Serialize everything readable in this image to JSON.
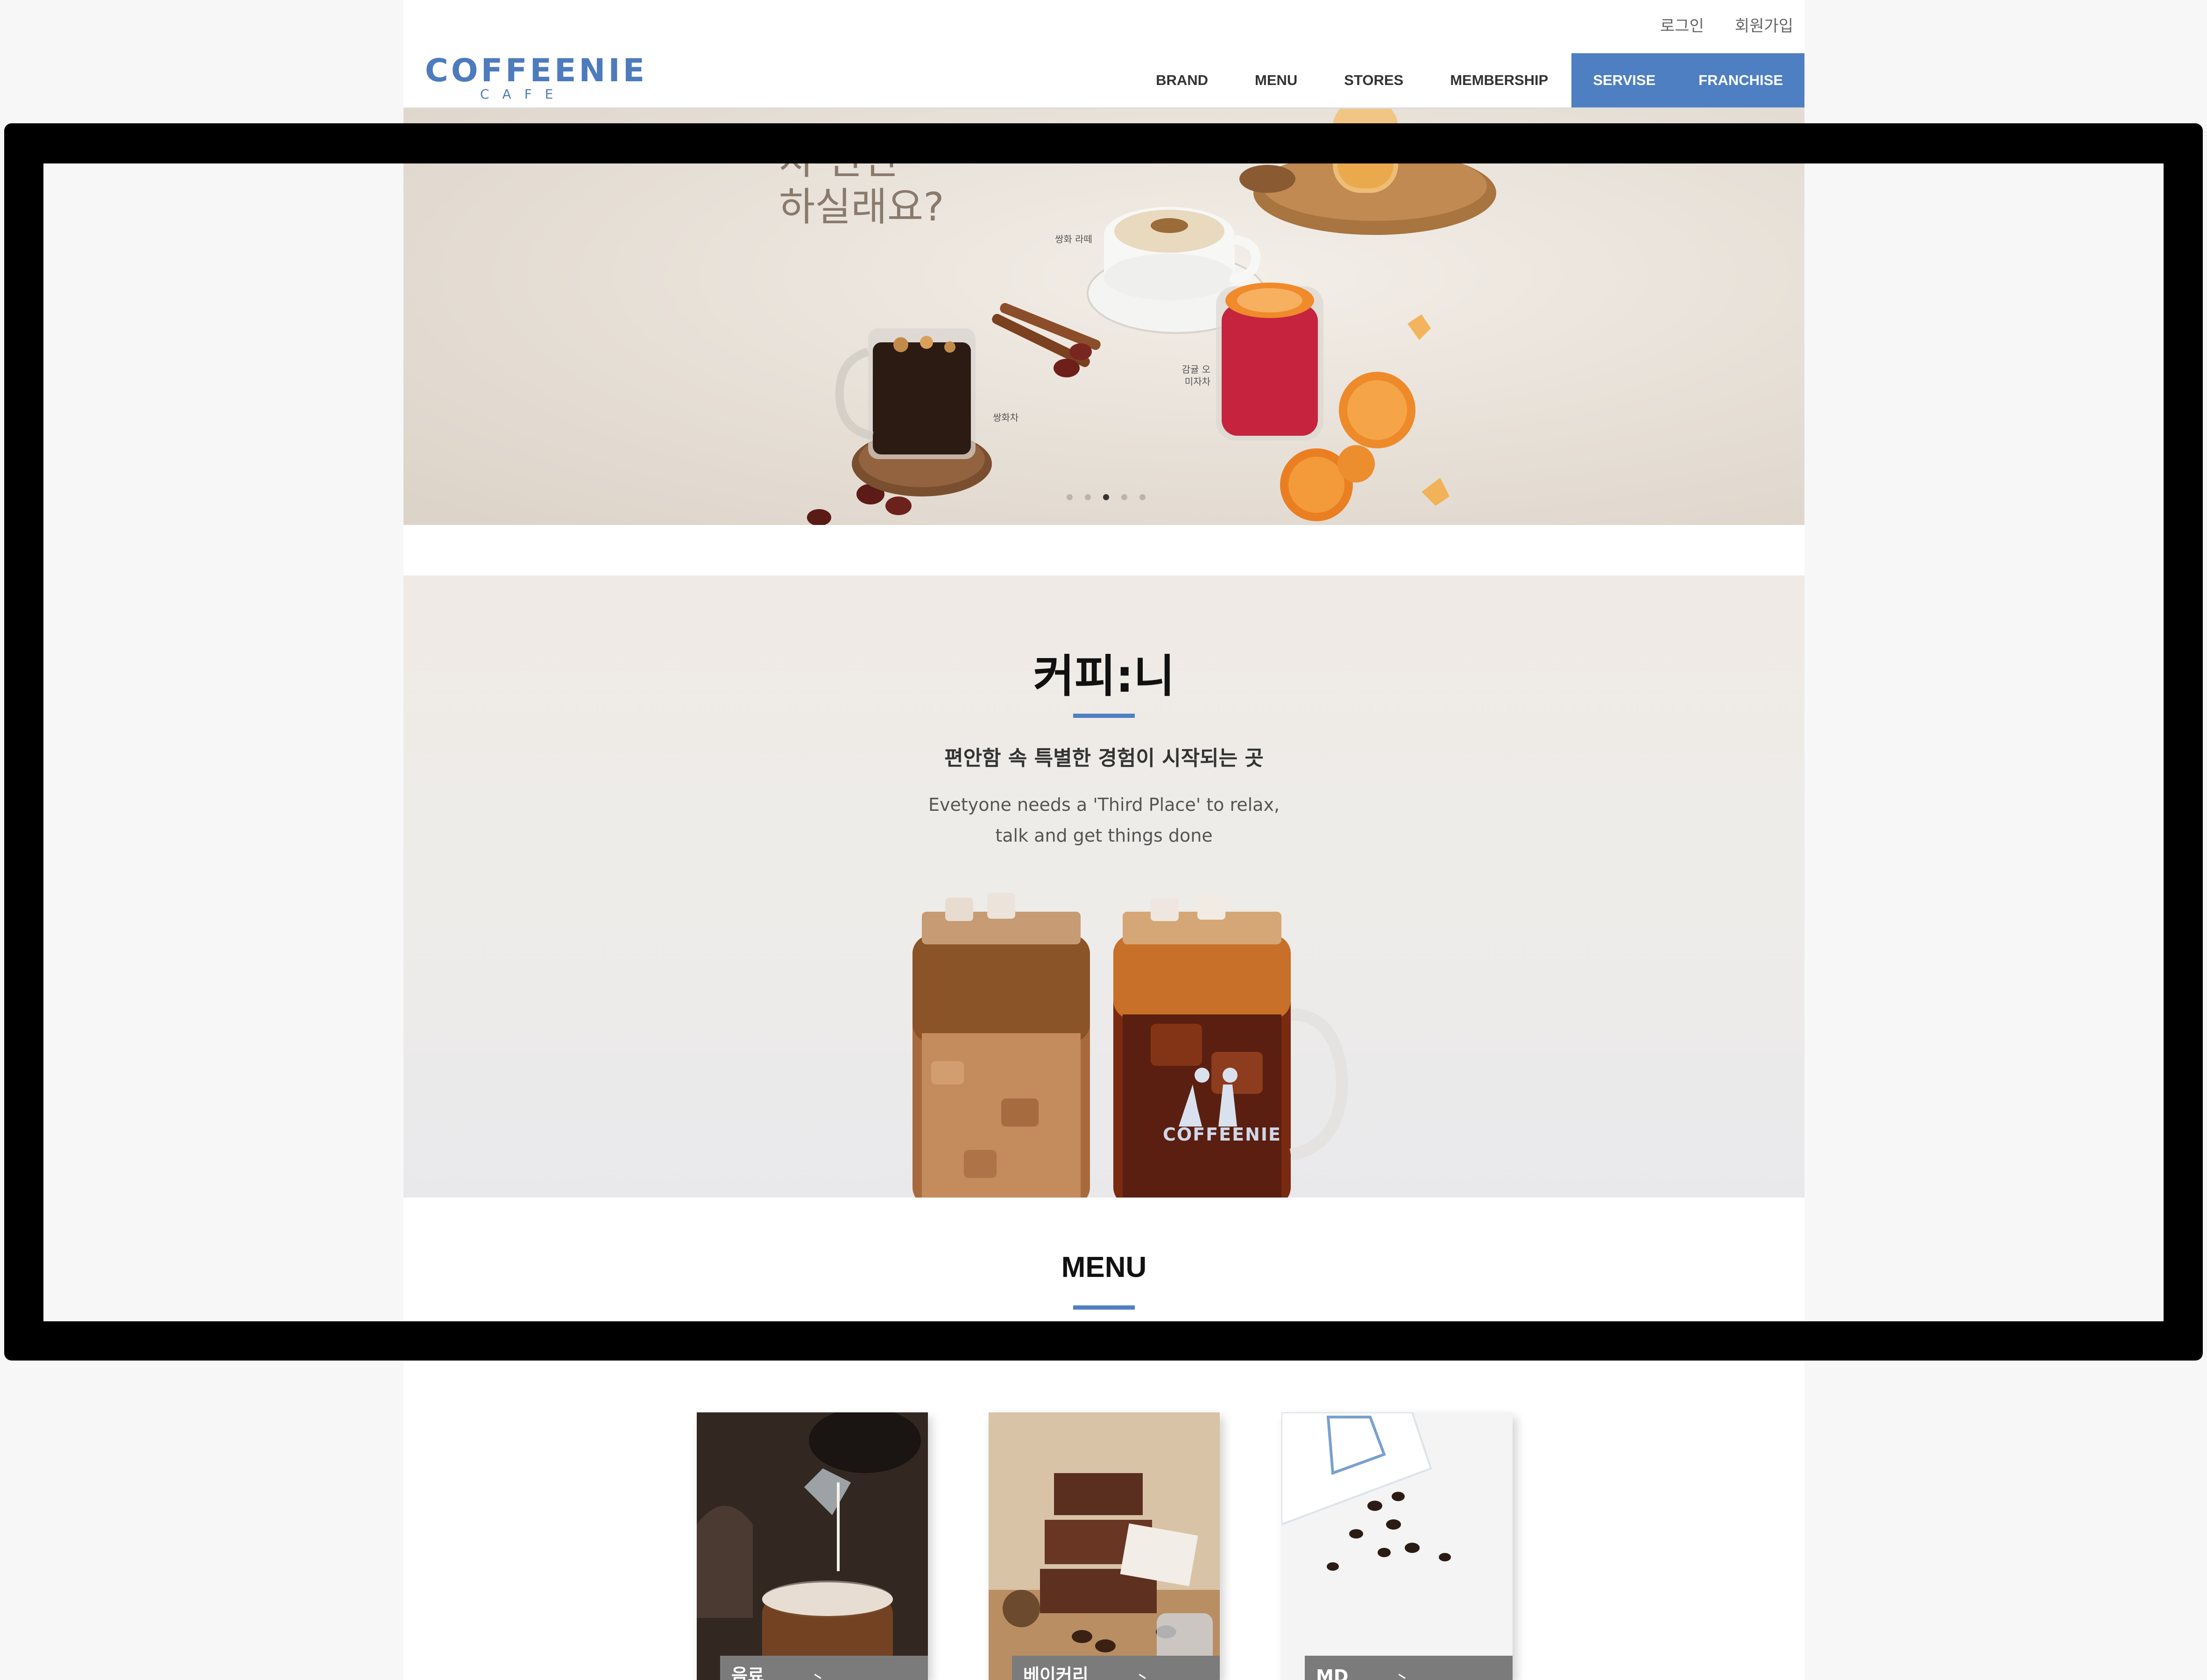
{
  "header": {
    "util_links": [
      "로그인",
      "회원가입"
    ],
    "logo": {
      "main": "COFFEENIE",
      "sub": "CAFE"
    },
    "nav": [
      {
        "label": "BRAND",
        "highlight": false
      },
      {
        "label": "MENU",
        "highlight": false
      },
      {
        "label": "STORES",
        "highlight": false
      },
      {
        "label": "MEMBERSHIP",
        "highlight": false
      },
      {
        "label": "SERVISE",
        "highlight": true
      },
      {
        "label": "FRANCHISE",
        "highlight": true
      }
    ],
    "accent_color": "#4e7fc3"
  },
  "hero": {
    "lines": [
      "차 한잔",
      "하실래요?"
    ],
    "labels": {
      "latte": "쌍화 라떼",
      "ssanghwa": "쌍화차",
      "omija": "감귤 오미자차"
    },
    "slide_count": 5,
    "active_slide": 3
  },
  "intro": {
    "title": "커피:니",
    "subtitle": "편안함 속 특별한 경험이 시작되는 곳",
    "english": [
      "Evetyone needs a 'Third Place' to relax,",
      "talk and get things done"
    ],
    "jar_logo": "COFFEENIE"
  },
  "menu": {
    "title": "MENU",
    "cards": [
      {
        "label": "음료",
        "icon": "arrow-right-icon"
      },
      {
        "label": "베이커리",
        "icon": "arrow-right-icon"
      },
      {
        "label": "MD",
        "icon": "arrow-right-icon"
      }
    ]
  }
}
